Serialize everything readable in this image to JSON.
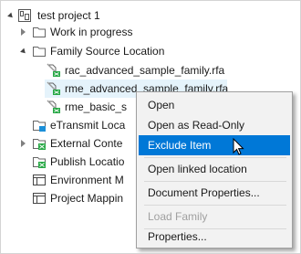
{
  "tree": {
    "project": "test project 1",
    "items": [
      {
        "label": "Work in progress"
      },
      {
        "label": "Family Source Location"
      },
      {
        "label": "rac_advanced_sample_family.rfa"
      },
      {
        "label": "rme_advanced_sample_family.rfa"
      },
      {
        "label": "rme_basic_s"
      },
      {
        "label": "eTransmit Loca"
      },
      {
        "label": "External Conte"
      },
      {
        "label": "Publish Locatio"
      },
      {
        "label": "Environment M"
      },
      {
        "label": "Project Mappin"
      }
    ]
  },
  "context_menu": {
    "items": [
      {
        "label": "Open"
      },
      {
        "label": "Open as Read-Only"
      },
      {
        "label": "Exclude Item"
      },
      {
        "label": "Open linked location"
      },
      {
        "label": "Document Properties..."
      },
      {
        "label": "Load Family"
      },
      {
        "label": "Properties..."
      }
    ]
  },
  "colors": {
    "highlight": "#0078d7",
    "selection": "#e5f3fb"
  }
}
